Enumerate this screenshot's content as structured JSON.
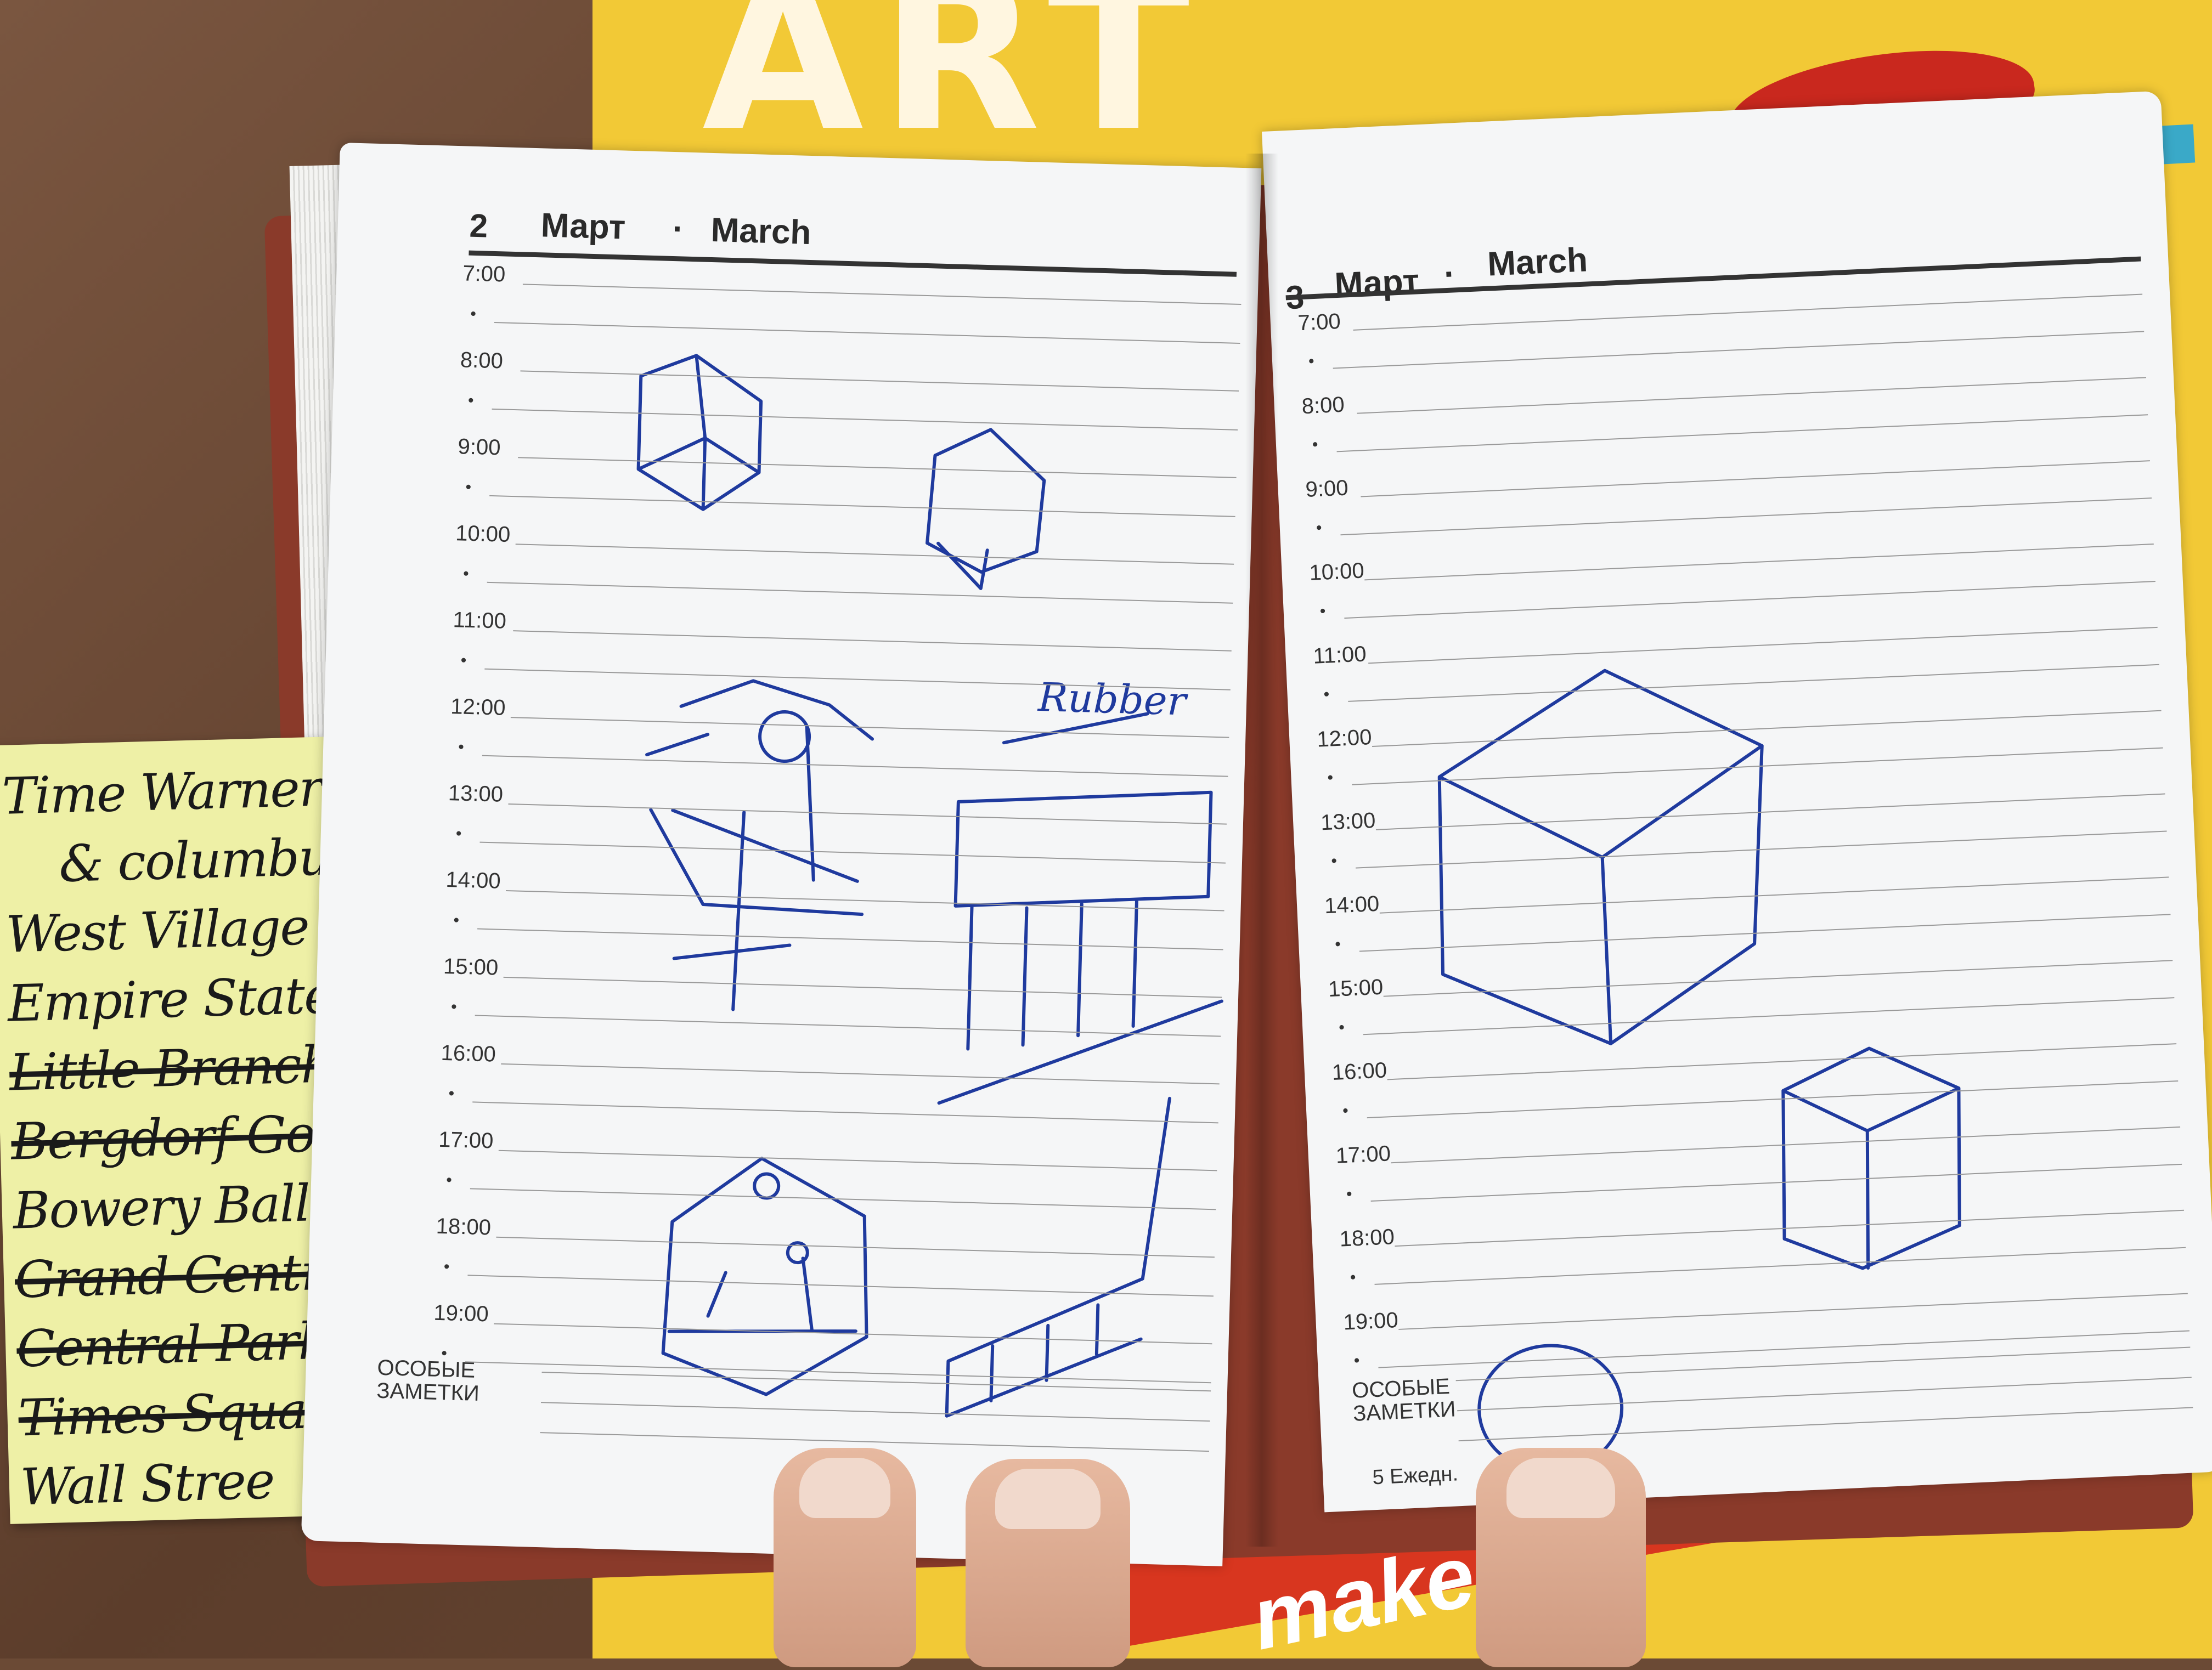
{
  "scene": {
    "magazine_title_fragment": "ART",
    "magazine_bottom_word": "make"
  },
  "sticky_note": {
    "lines": [
      {
        "text": "Time Warner",
        "struck": false
      },
      {
        "text": "& columbus c",
        "struck": false
      },
      {
        "text": "West Village",
        "struck": false
      },
      {
        "text": "Empire State Buildin",
        "struck": false
      },
      {
        "text": "Little Branch (R",
        "struck": true
      },
      {
        "text": "Bergdorf Goodm",
        "struck": true
      },
      {
        "text": "Bowery Ballroo",
        "struck": false
      },
      {
        "text": "Grand Central Te",
        "struck": true
      },
      {
        "text": "Central Park",
        "struck": true
      },
      {
        "text": "Times Squa",
        "struck": true
      },
      {
        "text": "Wall Stree",
        "struck": false
      }
    ]
  },
  "left_page": {
    "day": "2",
    "month_ru": "Март",
    "separator": "·",
    "month_en": "March",
    "slots": [
      "7:00",
      "8:00",
      "9:00",
      "10:00",
      "11:00",
      "12:00",
      "13:00",
      "14:00",
      "15:00",
      "16:00",
      "17:00",
      "18:00",
      "19:00"
    ],
    "notes_label": [
      "ОСОБЫЕ",
      "ЗАМЕТКИ"
    ],
    "sketch_label": "Rubber"
  },
  "right_page": {
    "day": "3",
    "month_ru": "Март",
    "separator": "·",
    "month_en": "March",
    "slots": [
      "7:00",
      "8:00",
      "9:00",
      "10:00",
      "11:00",
      "12:00",
      "13:00",
      "14:00",
      "15:00",
      "16:00",
      "17:00",
      "18:00",
      "19:00"
    ],
    "notes_label": [
      "ОСОБЫЕ",
      "ЗАМЕТКИ"
    ],
    "footer": "5 Ежедн."
  },
  "colors": {
    "ink": "#1f3a9e",
    "paper": "#f5f6f7",
    "magazine": "#f2c936",
    "sticky": "#eef0a6"
  }
}
